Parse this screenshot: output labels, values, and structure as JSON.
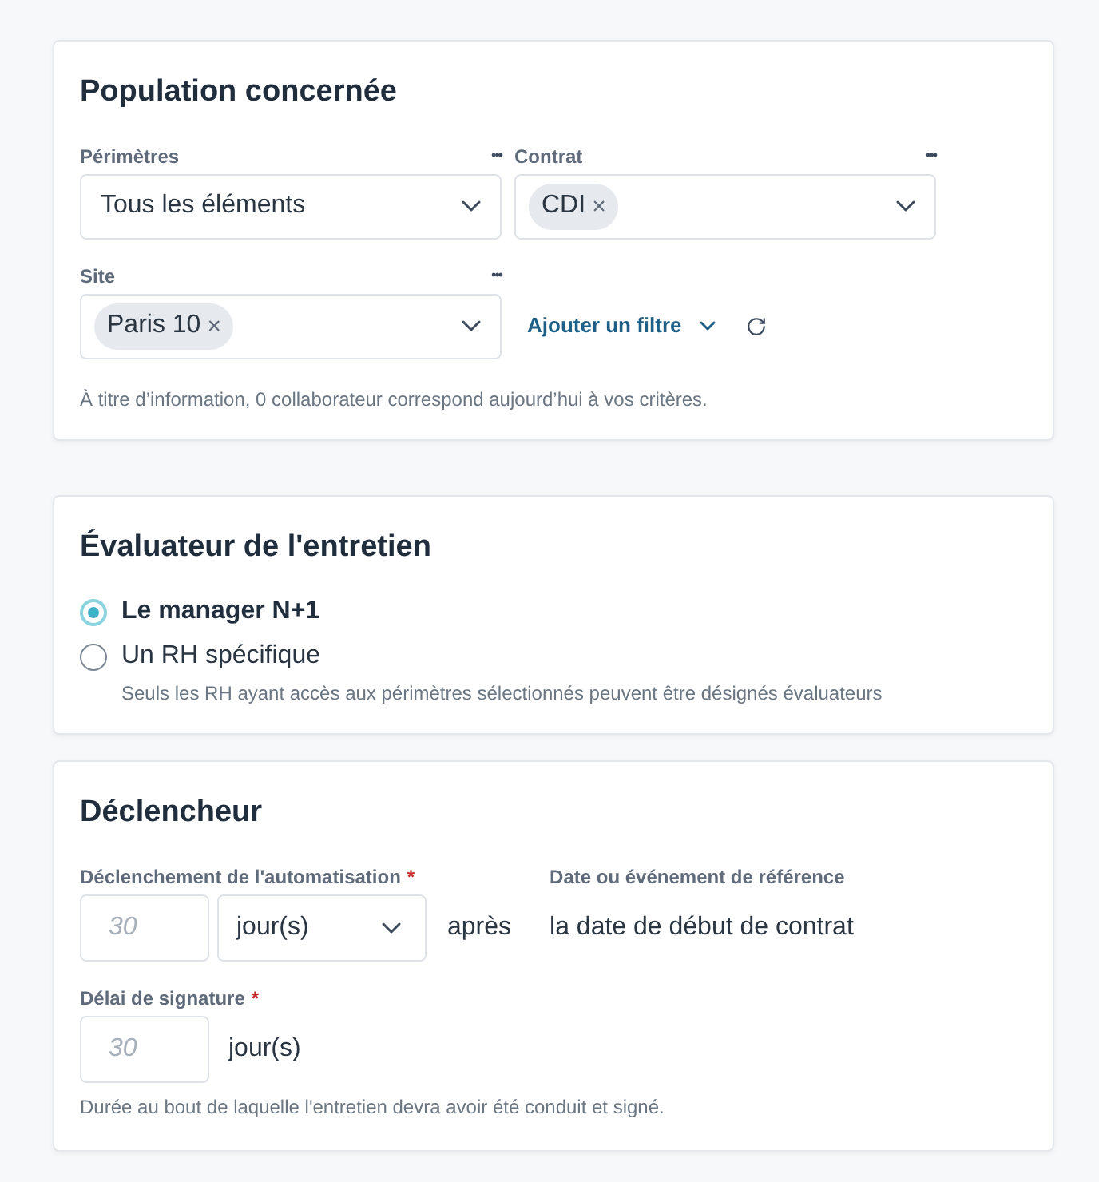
{
  "population": {
    "title": "Population concernée",
    "filters": [
      {
        "label": "Périmètres",
        "menu": "•••",
        "value": "Tous les éléments"
      },
      {
        "label": "Contrat",
        "menu": "•••",
        "chips": [
          "CDI"
        ]
      },
      {
        "label": "Site",
        "menu": "•••",
        "chips": [
          "Paris 10"
        ]
      }
    ],
    "chip_remove": "×",
    "add_filter": "Ajouter un filtre",
    "info": "À titre d’information, 0 collaborateur correspond aujourd’hui à vos critères."
  },
  "evaluator": {
    "title": "Évaluateur de l'entretien",
    "options": [
      {
        "label": "Le manager N+1",
        "selected": true
      },
      {
        "label": "Un RH spécifique",
        "selected": false,
        "hint": "Seuls les RH ayant accès aux périmètres sélectionnés peuvent être désignés évaluateurs"
      }
    ]
  },
  "trigger": {
    "title": "Déclencheur",
    "automation": {
      "label": "Déclenchement de l'automatisation",
      "required_mark": "*",
      "placeholder": "30",
      "unit": "jour(s)",
      "connector": "après"
    },
    "reference": {
      "label": "Date ou événement de référence",
      "value": "la date de début de contrat"
    },
    "signature": {
      "label": "Délai de signature",
      "required_mark": "*",
      "placeholder": "30",
      "unit": "jour(s)",
      "hint": "Durée au bout de laquelle l'entretien devra avoir été conduit et signé."
    }
  }
}
